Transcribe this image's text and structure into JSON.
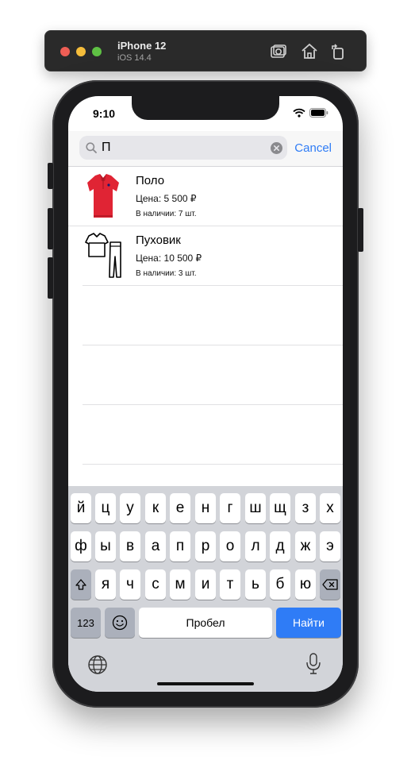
{
  "simulator": {
    "device_name": "iPhone 12",
    "os_version": "iOS 14.4"
  },
  "status_bar": {
    "time": "9:10"
  },
  "search": {
    "query": "П",
    "cancel_label": "Cancel"
  },
  "products": [
    {
      "name": "Поло",
      "price": "Цена: 5 500 ₽",
      "stock": "В наличии: 7 шт.",
      "icon": "red-polo-shirt"
    },
    {
      "name": "Пуховик",
      "price": "Цена: 10 500 ₽",
      "stock": "В наличии: 3 шт.",
      "icon": "clothes-outline"
    }
  ],
  "keyboard": {
    "row1": [
      "й",
      "ц",
      "у",
      "к",
      "е",
      "н",
      "г",
      "ш",
      "щ",
      "з",
      "х"
    ],
    "row2": [
      "ф",
      "ы",
      "в",
      "а",
      "п",
      "р",
      "о",
      "л",
      "д",
      "ж",
      "э"
    ],
    "row3": [
      "я",
      "ч",
      "с",
      "м",
      "и",
      "т",
      "ь",
      "б",
      "ю"
    ],
    "numbers_key": "123",
    "space_key": "Пробел",
    "return_key": "Найти"
  },
  "colors": {
    "accent": "#2f7cf6",
    "polo_red": "#e02434"
  }
}
